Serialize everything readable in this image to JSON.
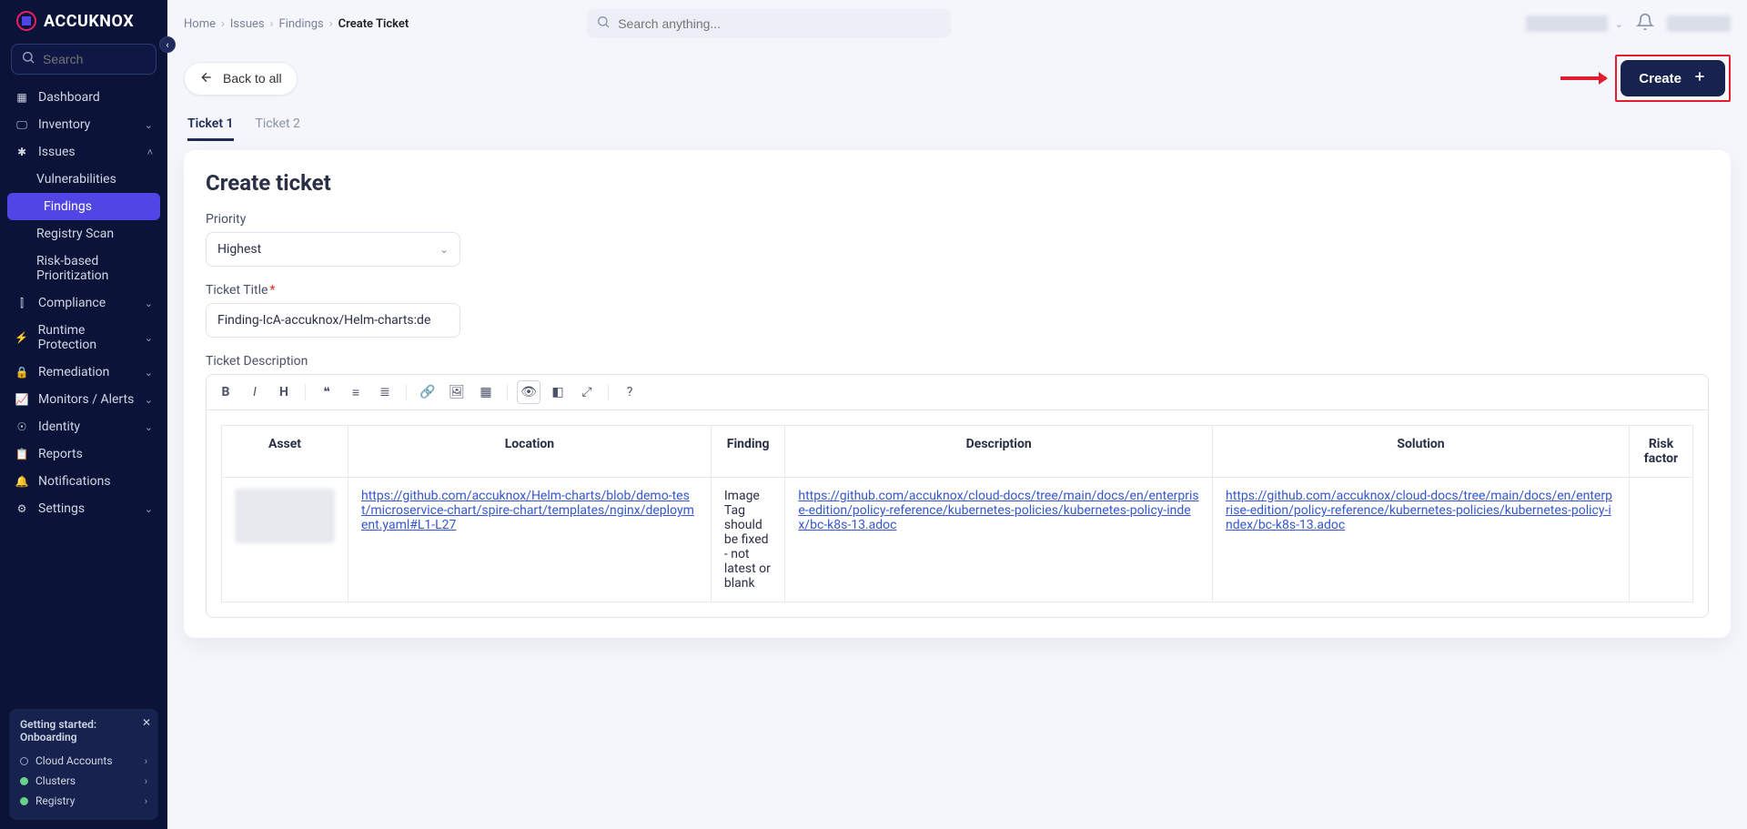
{
  "brand": "ACCUKNOX",
  "sidebar_search_placeholder": "Search",
  "nav": {
    "dashboard": "Dashboard",
    "inventory": "Inventory",
    "issues": "Issues",
    "issues_items": {
      "vuln": "Vulnerabilities",
      "findings": "Findings",
      "registry": "Registry Scan",
      "risk": "Risk-based Prioritization"
    },
    "compliance": "Compliance",
    "runtime": "Runtime Protection",
    "remediation": "Remediation",
    "monitors": "Monitors / Alerts",
    "identity": "Identity",
    "reports": "Reports",
    "notifications": "Notifications",
    "settings": "Settings"
  },
  "onboarding": {
    "title": "Getting started: Onboarding",
    "items": [
      "Cloud Accounts",
      "Clusters",
      "Registry"
    ]
  },
  "breadcrumbs": [
    "Home",
    "Issues",
    "Findings",
    "Create Ticket"
  ],
  "top_search_placeholder": "Search anything...",
  "back_label": "Back to all",
  "create_label": "Create",
  "tabs": [
    "Ticket 1",
    "Ticket 2"
  ],
  "form": {
    "title": "Create ticket",
    "priority_label": "Priority",
    "priority_value": "Highest",
    "ticket_title_label": "Ticket Title",
    "ticket_title_value": "Finding-IcA-accuknox/Helm-charts:de",
    "desc_label": "Ticket Description"
  },
  "table": {
    "headers": {
      "asset": "Asset",
      "location": "Location",
      "finding": "Finding",
      "description": "Description",
      "solution": "Solution",
      "risk": "Risk factor"
    },
    "row": {
      "location": "https://github.com/accuknox/Helm-charts/blob/demo-test/microservice-chart/spire-chart/templates/nginx/deployment.yaml#L1-L27",
      "finding": "Image Tag should be fixed - not latest or blank",
      "description": "https://github.com/accuknox/cloud-docs/tree/main/docs/en/enterprise-edition/policy-reference/kubernetes-policies/kubernetes-policy-index/bc-k8s-13.adoc",
      "solution": "https://github.com/accuknox/cloud-docs/tree/main/docs/en/enterprise-edition/policy-reference/kubernetes-policies/kubernetes-policy-index/bc-k8s-13.adoc"
    }
  }
}
